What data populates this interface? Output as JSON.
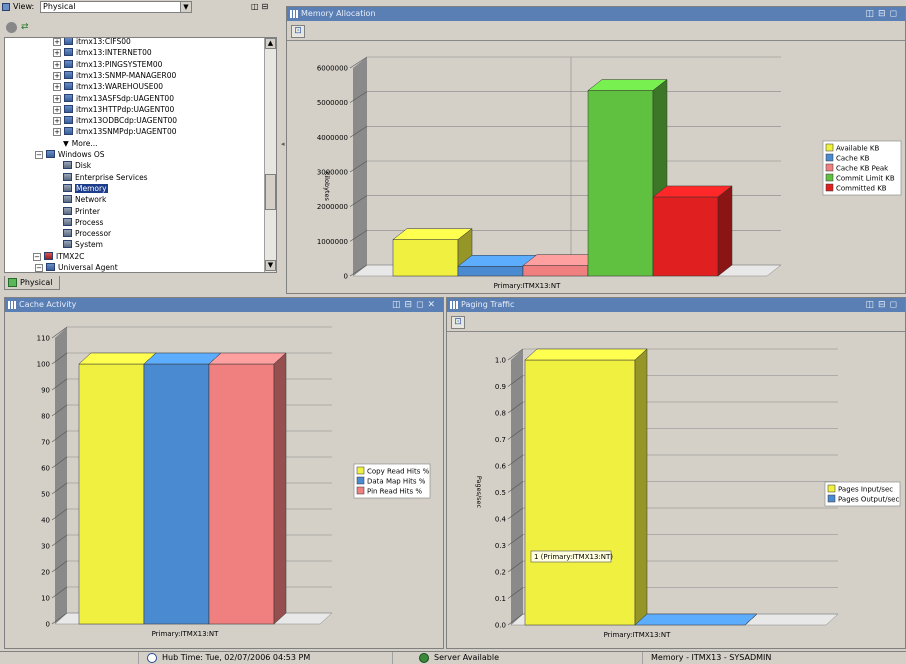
{
  "navigator": {
    "view_label": "View:",
    "view_value": "Physical",
    "tab_label": "Physical",
    "tree": [
      {
        "label": "itmx13:CIFS00",
        "indent": 1,
        "type": "agent"
      },
      {
        "label": "itmx13:INTERNET00",
        "indent": 1,
        "type": "agent"
      },
      {
        "label": "itmx13:PINGSYSTEM00",
        "indent": 1,
        "type": "agent"
      },
      {
        "label": "itmx13:SNMP-MANAGER00",
        "indent": 1,
        "type": "agent"
      },
      {
        "label": "itmx13:WAREHOUSE00",
        "indent": 1,
        "type": "agent"
      },
      {
        "label": "itmx13ASFSdp:UAGENT00",
        "indent": 1,
        "type": "agent"
      },
      {
        "label": "itmx13HTTPdp:UAGENT00",
        "indent": 1,
        "type": "agent"
      },
      {
        "label": "itmx13ODBCdp:UAGENT00",
        "indent": 1,
        "type": "agent"
      },
      {
        "label": "itmx13SNMPdp:UAGENT00",
        "indent": 1,
        "type": "agent"
      },
      {
        "label": "More...",
        "indent": 2,
        "type": "more"
      },
      {
        "label": "Windows OS",
        "indent": 0,
        "type": "folder"
      },
      {
        "label": "Disk",
        "indent": 2,
        "type": "ws"
      },
      {
        "label": "Enterprise Services",
        "indent": 2,
        "type": "ws"
      },
      {
        "label": "Memory",
        "indent": 2,
        "type": "ws",
        "selected": true
      },
      {
        "label": "Network",
        "indent": 2,
        "type": "ws"
      },
      {
        "label": "Printer",
        "indent": 2,
        "type": "ws"
      },
      {
        "label": "Process",
        "indent": 2,
        "type": "ws"
      },
      {
        "label": "Processor",
        "indent": 2,
        "type": "ws"
      },
      {
        "label": "System",
        "indent": 2,
        "type": "ws"
      },
      {
        "label": "ITMX2C",
        "indent": -1,
        "type": "host"
      },
      {
        "label": "Universal Agent",
        "indent": 0,
        "type": "folder"
      }
    ]
  },
  "panels": {
    "memory_title": "Memory Allocation",
    "cache_title": "Cache Activity",
    "paging_title": "Paging Traffic"
  },
  "status": {
    "hub_time": "Hub Time: Tue, 02/07/2006 04:53 PM",
    "server": "Server Available",
    "workspace": "Memory - ITMX13 - SYSADMIN"
  },
  "colors": {
    "yellow": "#f0f040",
    "blue": "#4a8ad0",
    "pink": "#f08080",
    "green": "#60c040",
    "red": "#e02020"
  },
  "chart_data": [
    {
      "type": "bar",
      "title": "Memory Allocation",
      "xlabel": "Primary:ITMX13:NT",
      "ylabel": "Kilobytes",
      "ylim": [
        0,
        6000000
      ],
      "yticks": [
        "0",
        "1000000",
        "2000000",
        "3000000",
        "4000000",
        "5000000",
        "6000000"
      ],
      "series": [
        {
          "name": "Available KB",
          "values": [
            1050000
          ],
          "color": "yellow"
        },
        {
          "name": "Cache KB",
          "values": [
            280000
          ],
          "color": "blue"
        },
        {
          "name": "Cache KB Peak",
          "values": [
            300000
          ],
          "color": "pink"
        },
        {
          "name": "Commit Limit KB",
          "values": [
            5350000
          ],
          "color": "green"
        },
        {
          "name": "Committed KB",
          "values": [
            2280000
          ],
          "color": "red"
        }
      ],
      "legend": "right"
    },
    {
      "type": "bar",
      "title": "Cache Activity",
      "xlabel": "Primary:ITMX13:NT",
      "ylim": [
        0,
        110
      ],
      "yticks": [
        "0",
        "10",
        "20",
        "30",
        "40",
        "50",
        "60",
        "70",
        "80",
        "90",
        "100",
        "110"
      ],
      "series": [
        {
          "name": "Copy Read Hits %",
          "values": [
            100
          ],
          "color": "yellow"
        },
        {
          "name": "Data Map Hits %",
          "values": [
            100
          ],
          "color": "blue"
        },
        {
          "name": "Pin Read Hits %",
          "values": [
            100
          ],
          "color": "pink"
        }
      ],
      "legend": "right"
    },
    {
      "type": "bar",
      "title": "Paging Traffic",
      "xlabel": "Primary:ITMX13:NT",
      "ylabel": "Pages/sec",
      "ylim": [
        0,
        1.0
      ],
      "yticks": [
        "0.0",
        "0.1",
        "0.2",
        "0.3",
        "0.4",
        "0.5",
        "0.6",
        "0.7",
        "0.8",
        "0.9",
        "1.0"
      ],
      "series": [
        {
          "name": "Pages Input/sec",
          "values": [
            1.0
          ],
          "color": "yellow"
        },
        {
          "name": "Pages Output/sec",
          "values": [
            0.0
          ],
          "color": "blue"
        }
      ],
      "annotation": "1 (Primary:ITMX13:NT)",
      "legend": "right"
    }
  ]
}
